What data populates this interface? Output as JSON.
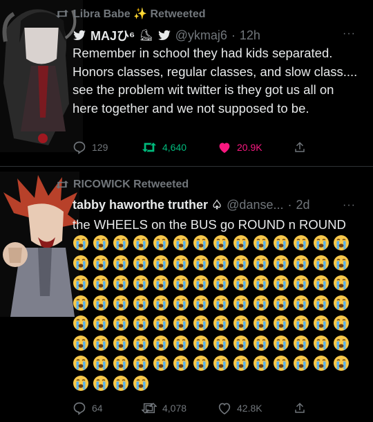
{
  "tweets": [
    {
      "retweeted_by": "Libra Babe ✨ Retweeted",
      "display_name": "MAJひ⁶",
      "name_suffix": "⛸",
      "handle": "@ykmaj6",
      "dot": "·",
      "time": "12h",
      "text": "Remember in school they had kids separated. Honors classes, regular classes, and slow class.... see the problem wit twitter is they got us all on here together and we not supposed to be.",
      "replies": "129",
      "retweets": "4,640",
      "likes": "20.9K",
      "liked": true,
      "avatar_icon": "anime-avatar-icon"
    },
    {
      "retweeted_by": "RICOWICK Retweeted",
      "display_name": "tabby haworthe truther ♤",
      "handle": "@danse...",
      "dot": "·",
      "time": "2d",
      "text": "the WHEELS on the BUS go ROUND n ROUND",
      "emoji": "😭",
      "emoji_count": 102,
      "replies": "64",
      "retweets": "4,078",
      "likes": "42.8K",
      "liked": false,
      "avatar_icon": "anime-avatar-icon"
    }
  ],
  "colors": {
    "text": "#e7e9ea",
    "muted": "#71767b",
    "like": "#f91880",
    "bg": "#000000"
  }
}
